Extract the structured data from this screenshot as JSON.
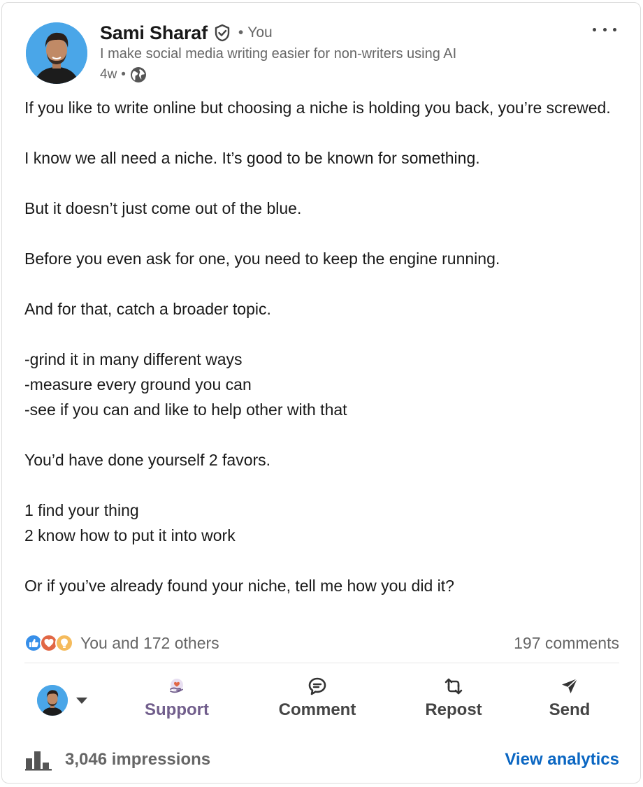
{
  "post": {
    "author": {
      "name": "Sami Sharaf",
      "relation": "You",
      "separator": "•",
      "headline": "I make social media writing easier for non-writers using AI",
      "time": "4w",
      "time_sep": "•",
      "verified_icon": "shield-check-icon",
      "visibility_icon": "globe-icon"
    },
    "more_icon": "more-horizontal-icon",
    "paragraphs": [
      "If you like to write online but choosing a niche is holding you back, you’re screwed.",
      "",
      "I know we all need a niche. It’s good to be known for something.",
      "",
      "But it doesn’t just come out of the blue.",
      "",
      "Before you even ask for one, you need to keep the engine running.",
      "",
      "And for that, catch a broader topic.",
      "",
      "-grind it in many different ways",
      "-measure every ground you can",
      "-see if you can and like to help other with that",
      "",
      "You’d have done yourself 2 favors.",
      "",
      "1 find your thing",
      "2 know how to put it into work",
      "",
      "Or if you’ve already found your niche, tell me how you did it?"
    ]
  },
  "social": {
    "reactions_text": "You and 172 others",
    "comments_text": "197 comments",
    "reaction_icons": [
      "like-icon",
      "support-heart-icon",
      "insightful-bulb-icon"
    ]
  },
  "actions": {
    "support": "Support",
    "comment": "Comment",
    "repost": "Repost",
    "send": "Send"
  },
  "footer": {
    "impressions": "3,046 impressions",
    "view_analytics": "View analytics"
  },
  "colors": {
    "link_blue": "#0a66c2",
    "support_purple": "#715e8c",
    "muted_text": "#666666"
  }
}
